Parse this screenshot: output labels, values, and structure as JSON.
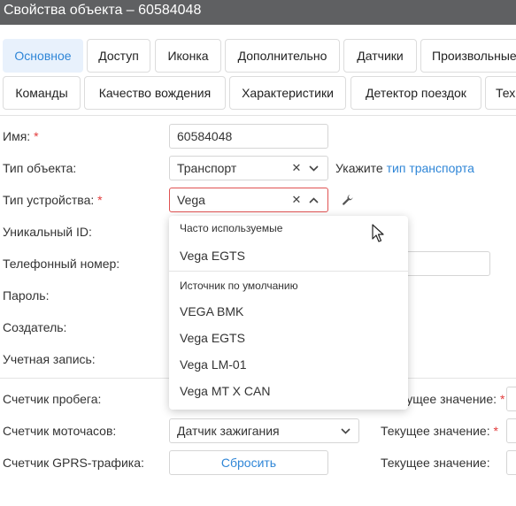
{
  "window": {
    "title": "Свойства объекта – 60584048"
  },
  "tabs_row1": [
    {
      "label": "Основное",
      "active": true
    },
    {
      "label": "Доступ",
      "active": false
    },
    {
      "label": "Иконка",
      "active": false
    },
    {
      "label": "Дополнительно",
      "active": false
    },
    {
      "label": "Датчики",
      "active": false
    },
    {
      "label": "Произвольные",
      "active": false
    }
  ],
  "tabs_row2": [
    {
      "label": "Команды"
    },
    {
      "label": "Качество вождения"
    },
    {
      "label": "Характеристики"
    },
    {
      "label": "Детектор поездок"
    },
    {
      "label": "Тех"
    }
  ],
  "form": {
    "name": {
      "label": "Имя:",
      "required": "*",
      "value": "60584048"
    },
    "object_type": {
      "label": "Тип объекта:",
      "value": "Транспорт",
      "hint_prefix": "Укажите",
      "hint_link": "тип транспорта"
    },
    "device_type": {
      "label": "Тип устройства:",
      "required": "*",
      "value": "Vega"
    },
    "unique_id": {
      "label": "Уникальный ID:"
    },
    "phone": {
      "label": "Телефонный номер:"
    },
    "password": {
      "label": "Пароль:"
    },
    "creator": {
      "label": "Создатель:"
    },
    "account": {
      "label": "Учетная запись:"
    },
    "mileage_counter": {
      "label": "Счетчик пробега:",
      "current_label": "кущее значение:",
      "current_required": "*"
    },
    "engine_hours_counter": {
      "label": "Счетчик моточасов:",
      "value": "Датчик зажигания",
      "current_label": "Текущее значение:",
      "current_required": "*"
    },
    "gprs_counter": {
      "label": "Счетчик GPRS-трафика:",
      "reset_label": "Сбросить",
      "current_label": "Текущее значение:"
    }
  },
  "dropdown": {
    "group_frequent": "Часто используемые",
    "frequent_items": [
      "Vega EGTS"
    ],
    "group_default": "Источник по умолчанию",
    "default_items": [
      "VEGA BMK",
      "Vega EGTS",
      "Vega LM-01",
      "Vega MT X CAN"
    ]
  },
  "icons": {
    "clear": "close-icon",
    "chevron_down": "chevron-down-icon",
    "chevron_up": "chevron-up-icon",
    "wrench": "wrench-icon",
    "cursor": "mouse-pointer-icon"
  },
  "colors": {
    "titlebar": "#5f6062",
    "accent": "#2f86d7",
    "active_tab_bg": "#e8f1fc",
    "required": "#e23b3b",
    "error_border": "#e05252"
  }
}
